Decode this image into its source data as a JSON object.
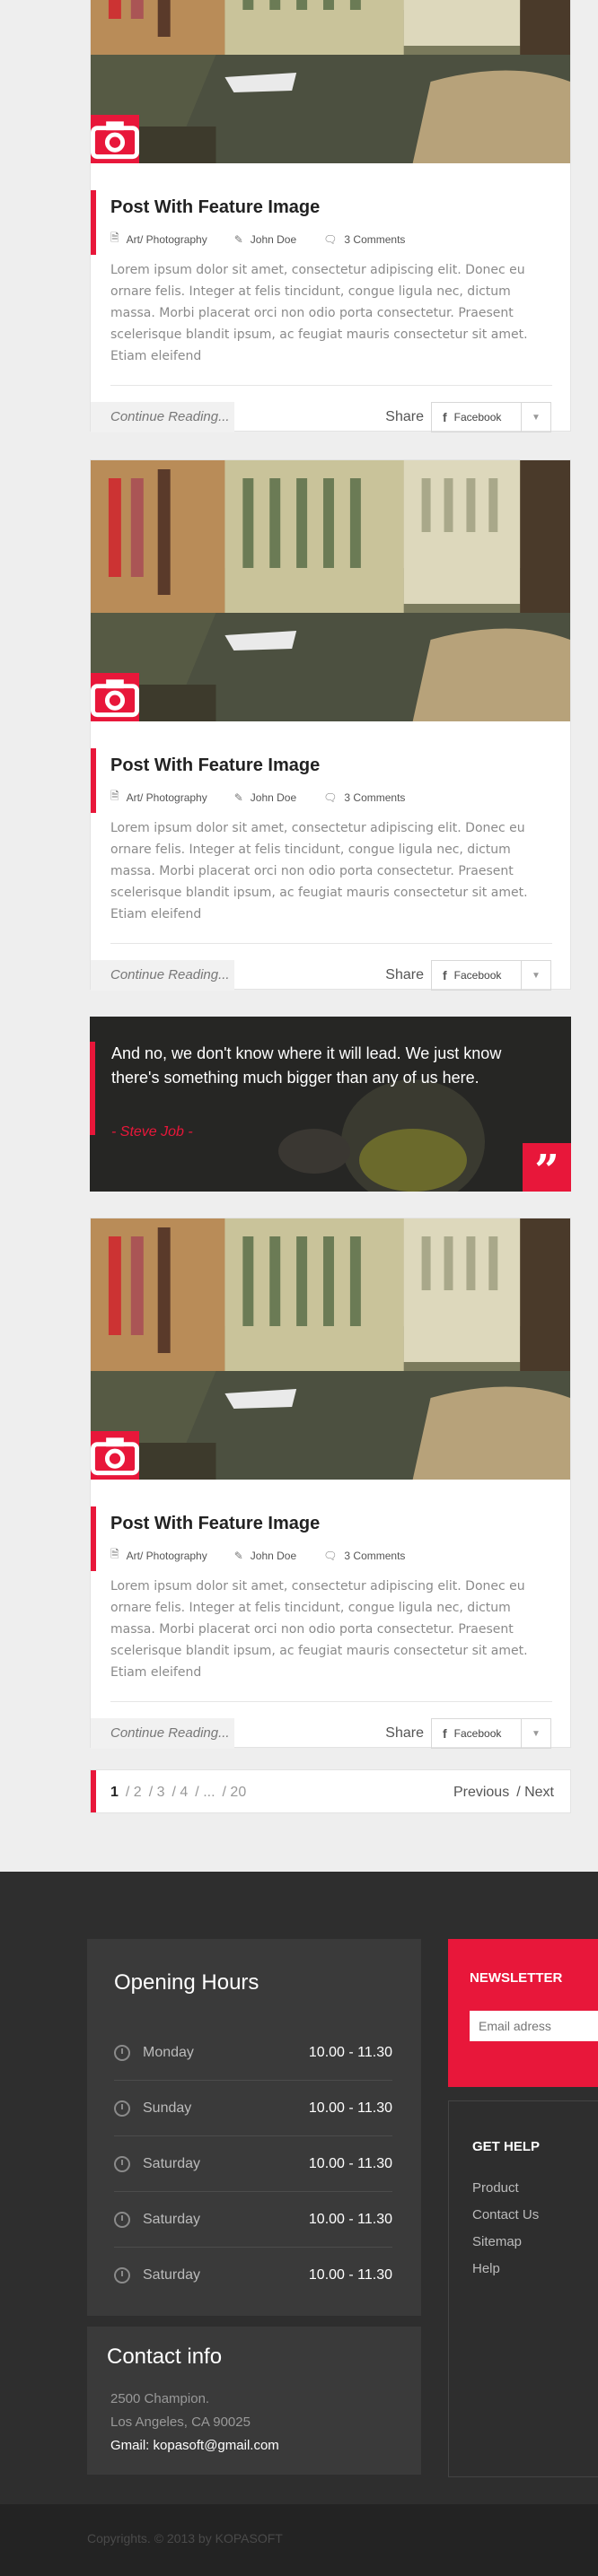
{
  "posts": [
    {
      "title": "Post With Feature Image",
      "category": "Art/ Photography",
      "author": "John Doe",
      "comments": "3 Comments",
      "excerpt": "Lorem ipsum dolor sit amet, consectetur adipiscing elit. Donec eu ornare felis. Integer at felis tincidunt, congue ligula nec, dictum massa. Morbi placerat orci non odio porta consectetur. Praesent scelerisque blandit ipsum, ac feugiat mauris consectetur sit amet. Etiam eleifend",
      "continue_label": "Continue Reading...",
      "share_label": "Share",
      "facebook_label": "Facebook"
    },
    {
      "title": "Post With Feature Image",
      "category": "Art/ Photography",
      "author": "John Doe",
      "comments": "3 Comments",
      "excerpt": "Lorem ipsum dolor sit amet, consectetur adipiscing elit. Donec eu ornare felis. Integer at felis tincidunt, congue ligula nec, dictum massa. Morbi placerat orci non odio porta consectetur. Praesent scelerisque blandit ipsum, ac feugiat mauris consectetur sit amet. Etiam eleifend",
      "continue_label": "Continue Reading...",
      "share_label": "Share",
      "facebook_label": "Facebook"
    },
    {
      "title": "Post With Feature Image",
      "category": "Art/ Photography",
      "author": "John Doe",
      "comments": "3 Comments",
      "excerpt": "Lorem ipsum dolor sit amet, consectetur adipiscing elit. Donec eu ornare felis. Integer at felis tincidunt, congue ligula nec, dictum massa. Morbi placerat orci non odio porta consectetur. Praesent scelerisque blandit ipsum, ac feugiat mauris consectetur sit amet. Etiam eleifend",
      "continue_label": "Continue Reading...",
      "share_label": "Share",
      "facebook_label": "Facebook"
    }
  ],
  "quote": {
    "text": "And no, we don't know where it will lead. We just know there's something much bigger than any of us here.",
    "author": "- Steve Job -",
    "mark": "99"
  },
  "pagination": {
    "pages": [
      "1",
      "/ 2",
      "/ 3",
      "/ 4",
      "/ ...",
      "/ 20"
    ],
    "previous": "Previous",
    "next": "/ Next"
  },
  "footer": {
    "hours_title": "Opening Hours",
    "hours": [
      {
        "day": "Monday",
        "time": "10.00 - 11.30"
      },
      {
        "day": "Sunday",
        "time": "10.00 - 11.30"
      },
      {
        "day": "Saturday",
        "time": "10.00 - 11.30"
      },
      {
        "day": "Saturday",
        "time": "10.00 - 11.30"
      },
      {
        "day": "Saturday",
        "time": "10.00 - 11.30"
      }
    ],
    "contact_title": "Contact info",
    "address1": "2500 Champion.",
    "address2": "Los Angeles, CA 90025",
    "email": "Gmail: kopasoft@gmail.com",
    "newsletter_title": "NEWSLETTER",
    "newsletter_placeholder": "Email adress",
    "help_title": "GET HELP",
    "help_links": [
      "Product",
      "Contact Us",
      "Sitemap",
      "Help"
    ],
    "copyright": "Copyrights. © 2013 by KOPASOFT"
  },
  "colors": {
    "accent": "#e8173a",
    "footer_bg": "#2e2e2e",
    "panel_bg": "#3a3a3a"
  },
  "icons": {
    "badge": "camera-icon",
    "quote": "quote-icon",
    "category": "document-icon",
    "author": "edit-icon",
    "comments": "comments-icon",
    "hours": "clock-icon"
  }
}
